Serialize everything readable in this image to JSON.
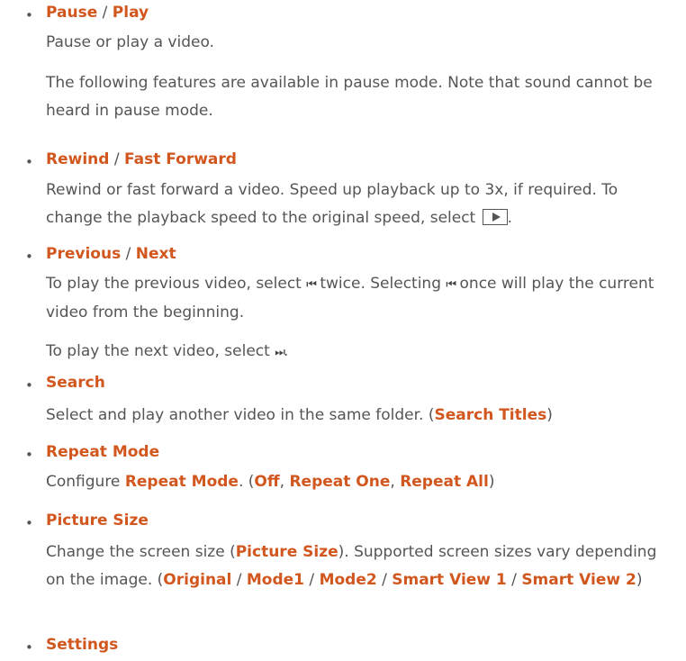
{
  "sections": [
    {
      "heading": {
        "a": "Pause",
        "sep": " / ",
        "b": "Play"
      },
      "paragraphs": [
        "Pause or play a video.",
        "The following features are available in pause mode. Note that sound cannot be heard in pause mode."
      ]
    },
    {
      "heading": {
        "a": "Rewind",
        "sep": " / ",
        "b": "Fast Forward"
      },
      "p1": "Rewind or fast forward a video. Speed up playback up to 3x, if required. To change the playback speed to the original speed, select",
      "p1_end": "."
    },
    {
      "heading": {
        "a": "Previous",
        "sep": " / ",
        "b": "Next"
      },
      "p1_a": "To play the previous video, select",
      "p1_b": "twice. Selecting",
      "p1_c": "once will play the current video from the beginning.",
      "p2_a": "To play the next video, select",
      "p2_b": ".",
      "glyph_prev": "⏮",
      "glyph_next": "⏭"
    },
    {
      "heading": "Search",
      "p1_a": "Select and play another video in the same folder. (",
      "p1_b": "Search Titles",
      "p1_c": ")"
    },
    {
      "heading": "Repeat Mode",
      "p1_a": "Configure ",
      "p1_b": "Repeat Mode",
      "p1_c": ". (",
      "opt1": "Off",
      "opt2": "Repeat One",
      "opt3": "Repeat All",
      "comma": ", ",
      "close": ")"
    },
    {
      "heading": "Picture Size",
      "p1_a": "Change the screen size (",
      "p1_b": "Picture Size",
      "p1_c": "). Supported screen sizes vary depending on the image. (",
      "opts": [
        "Original",
        "Mode1",
        "Mode2",
        "Smart View 1",
        "Smart View 2"
      ],
      "slash": " / ",
      "close": ")"
    },
    {
      "heading": "Settings"
    }
  ],
  "bullet": "•",
  "colors": {
    "accent": "#d2571f",
    "text": "#555555"
  }
}
